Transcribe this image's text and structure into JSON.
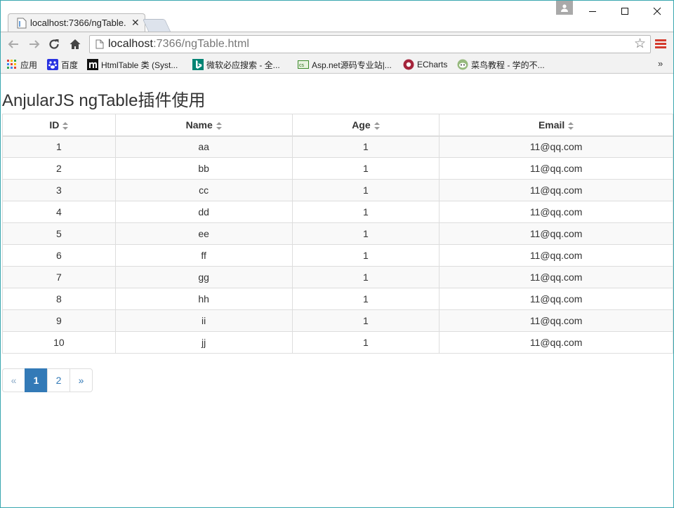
{
  "browser": {
    "tab_title": "localhost:7366/ngTable.",
    "url_host": "localhost",
    "url_rest": ":7366/ngTable.html"
  },
  "bookmarks": [
    {
      "label": "应用",
      "icon": "apps-grid-icon"
    },
    {
      "label": "百度",
      "icon": "baidu-paw-icon"
    },
    {
      "label": "HtmlTable 类 (Syst...",
      "icon": "msdn-m-icon"
    },
    {
      "label": "微软必应搜索 - 全...",
      "icon": "bing-icon"
    },
    {
      "label": "Asp.net源码专业站|...",
      "icon": "aspnet-icon"
    },
    {
      "label": "ECharts",
      "icon": "echarts-icon"
    },
    {
      "label": "菜鸟教程 - 学的不...",
      "icon": "runoob-icon"
    }
  ],
  "page": {
    "title": "AnjularJS ngTable插件使用"
  },
  "table": {
    "columns": [
      "ID",
      "Name",
      "Age",
      "Email"
    ],
    "rows": [
      [
        "1",
        "aa",
        "1",
        "11@qq.com"
      ],
      [
        "2",
        "bb",
        "1",
        "11@qq.com"
      ],
      [
        "3",
        "cc",
        "1",
        "11@qq.com"
      ],
      [
        "4",
        "dd",
        "1",
        "11@qq.com"
      ],
      [
        "5",
        "ee",
        "1",
        "11@qq.com"
      ],
      [
        "6",
        "ff",
        "1",
        "11@qq.com"
      ],
      [
        "7",
        "gg",
        "1",
        "11@qq.com"
      ],
      [
        "8",
        "hh",
        "1",
        "11@qq.com"
      ],
      [
        "9",
        "ii",
        "1",
        "11@qq.com"
      ],
      [
        "10",
        "jj",
        "1",
        "11@qq.com"
      ]
    ]
  },
  "pagination": {
    "prev": "«",
    "pages": [
      "1",
      "2"
    ],
    "active": "1",
    "next": "»"
  },
  "colors": {
    "accent": "#337ab7",
    "window_border": "#3aa7b0",
    "menu_red": "#d43b2e"
  }
}
